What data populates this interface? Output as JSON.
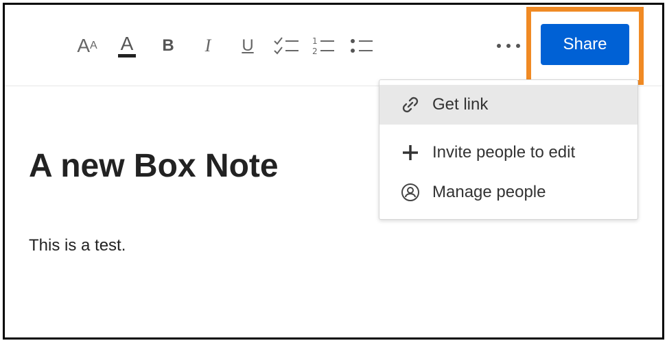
{
  "toolbar": {
    "text_size_icon": "text-size-icon",
    "text_color_icon": "text-color-icon",
    "bold_icon": "bold-icon",
    "italic_icon": "italic-icon",
    "underline_icon": "underline-icon",
    "checklist_icon": "checklist-icon",
    "numbered_list_icon": "numbered-list-icon",
    "bulleted_list_icon": "bulleted-list-icon",
    "more_icon": "more-options-icon",
    "share_label": "Share"
  },
  "note": {
    "title": "A new Box Note",
    "body": "This is a test."
  },
  "share_menu": {
    "items": [
      {
        "label": "Get link",
        "icon": "link-icon"
      },
      {
        "label": "Invite people to edit",
        "icon": "plus-icon"
      },
      {
        "label": "Manage people",
        "icon": "person-circle-icon"
      }
    ]
  },
  "colors": {
    "share_button": "#0061d5",
    "highlight_border": "#f08a24",
    "menu_hover": "#e8e8e8"
  }
}
